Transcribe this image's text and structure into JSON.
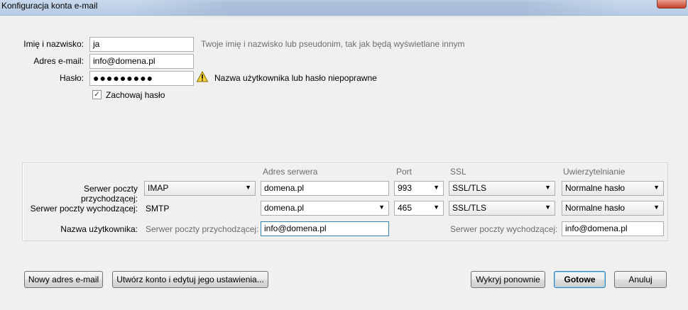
{
  "window": {
    "title": "Konfiguracja konta e-mail"
  },
  "identity": {
    "name_label": "Imię i nazwisko:",
    "name_value": "ja",
    "name_hint": "Twoje imię i nazwisko lub pseudonim, tak jak będą wyświetlane innym",
    "email_label": "Adres e-mail:",
    "email_value": "info@domena.pl",
    "password_label": "Hasło:",
    "password_value": "●●●●●●●●●",
    "password_warning": "Nazwa użytkownika lub hasło niepoprawne",
    "remember_label": "Zachowaj hasło",
    "remember_checked": true
  },
  "servers": {
    "headers": {
      "address": "Adres serwera",
      "port": "Port",
      "ssl": "SSL",
      "auth": "Uwierzytelnianie"
    },
    "incoming": {
      "label": "Serwer poczty przychodzącej:",
      "protocol": "IMAP",
      "address": "domena.pl",
      "port": "993",
      "ssl": "SSL/TLS",
      "auth": "Normalne hasło"
    },
    "outgoing": {
      "label": "Serwer poczty wychodzącej:",
      "protocol": "SMTP",
      "address": "domena.pl",
      "port": "465",
      "ssl": "SSL/TLS",
      "auth": "Normalne hasło"
    },
    "username": {
      "label": "Nazwa użytkownika:",
      "incoming_label": "Serwer poczty przychodzącej:",
      "incoming_value": "info@domena.pl",
      "outgoing_label": "Serwer poczty wychodzącej:",
      "outgoing_value": "info@domena.pl"
    }
  },
  "buttons": {
    "new_address": "Nowy adres e-mail",
    "create_edit": "Utwórz konto i edytuj jego ustawienia...",
    "redetect": "Wykryj ponownie",
    "done": "Gotowe",
    "cancel": "Anuluj"
  }
}
